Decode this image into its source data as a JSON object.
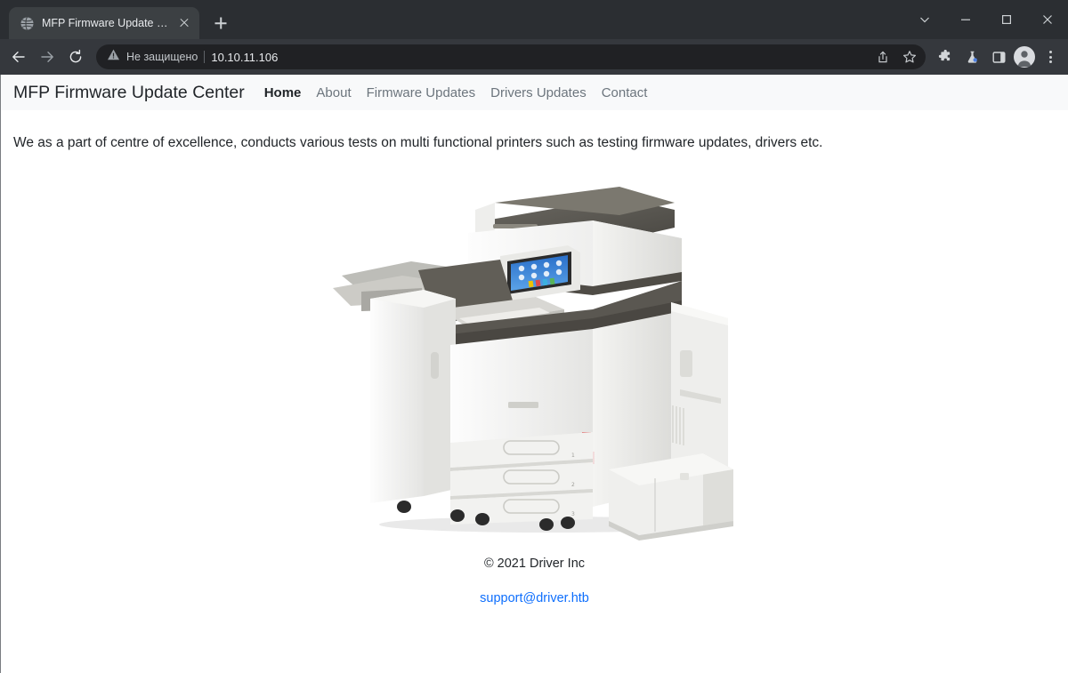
{
  "browser": {
    "tab": {
      "title": "MFP Firmware Update Center",
      "favicon_icon": "globe-icon",
      "close_icon": "close-icon"
    },
    "new_tab_icon": "plus-icon",
    "window_controls": {
      "tab_search_icon": "chevron-down-icon",
      "minimize_icon": "minimize-icon",
      "maximize_icon": "maximize-icon",
      "close_icon": "close-icon"
    },
    "toolbar": {
      "back_icon": "back-arrow-icon",
      "forward_icon": "forward-arrow-icon",
      "reload_icon": "reload-icon",
      "security_warning_icon": "warning-triangle-icon",
      "security_text": "Не защищено",
      "url": "10.10.11.106",
      "share_icon": "share-icon",
      "bookmark_icon": "star-icon",
      "extensions_icon": "puzzle-piece-icon",
      "labs_icon": "flask-icon",
      "side_panel_icon": "side-panel-icon",
      "profile_icon": "avatar-icon",
      "menu_icon": "three-dots-menu-icon"
    }
  },
  "page": {
    "nav": {
      "brand": "MFP Firmware Update Center",
      "links": [
        {
          "label": "Home",
          "active": true
        },
        {
          "label": "About",
          "active": false
        },
        {
          "label": "Firmware Updates",
          "active": false
        },
        {
          "label": "Drivers Updates",
          "active": false
        },
        {
          "label": "Contact",
          "active": false
        }
      ]
    },
    "intro": "We as a part of centre of excellence, conducts various tests on multi functional printers such as testing firmware updates, drivers etc.",
    "hero_image_alt": "multifunction-printer-photo",
    "footer": {
      "copyright": "© 2021 Driver Inc",
      "support_email": "support@driver.htb"
    }
  },
  "colors": {
    "chrome_tabstrip": "#2b2e32",
    "chrome_toolbar": "#35383d",
    "omnibox": "#202124",
    "nav_background": "#f8f9fa",
    "text": "#212529",
    "muted_text": "#6c757d",
    "link": "#0d6efd"
  }
}
